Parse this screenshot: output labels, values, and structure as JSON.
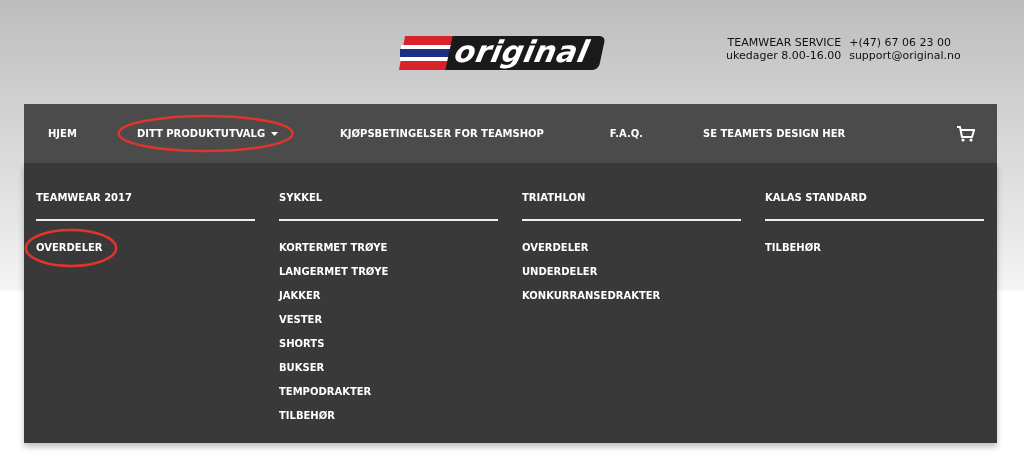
{
  "logo": {
    "text": "original"
  },
  "contact": [
    {
      "label": "TEAMWEAR SERVICE",
      "value": "+(47) 67 06 23 00"
    },
    {
      "label": "ukedager 8.00-16.00",
      "value": "support@original.no"
    }
  ],
  "nav": [
    {
      "label": "HJEM",
      "dropdown": false,
      "circled": false
    },
    {
      "label": "DITT PRODUKTUTVALG",
      "dropdown": true,
      "circled": true
    },
    {
      "label": "KJØPSBETINGELSER FOR TEAMSHOP",
      "dropdown": false,
      "circled": false
    },
    {
      "label": "F.A.Q.",
      "dropdown": false,
      "circled": false
    },
    {
      "label": "SE TEAMETS DESIGN HER",
      "dropdown": false,
      "circled": false
    }
  ],
  "menu_columns": [
    {
      "heading": "TEAMWEAR 2017",
      "items": [
        {
          "label": "OVERDELER",
          "circled": true
        }
      ]
    },
    {
      "heading": "SYKKEL",
      "items": [
        {
          "label": "KORTERMET TRØYE",
          "circled": false
        },
        {
          "label": "LANGERMET TRØYE",
          "circled": false
        },
        {
          "label": "JAKKER",
          "circled": false
        },
        {
          "label": "VESTER",
          "circled": false
        },
        {
          "label": "SHORTS",
          "circled": false
        },
        {
          "label": "BUKSER",
          "circled": false
        },
        {
          "label": "TEMPODRAKTER",
          "circled": false
        },
        {
          "label": "TILBEHØR",
          "circled": false
        }
      ]
    },
    {
      "heading": "TRIATHLON",
      "items": [
        {
          "label": "OVERDELER",
          "circled": false
        },
        {
          "label": "UNDERDELER",
          "circled": false
        },
        {
          "label": "KONKURRANSEDRAKTER",
          "circled": false
        }
      ]
    },
    {
      "heading": "KALAS STANDARD",
      "items": [
        {
          "label": "TILBEHØR",
          "circled": false
        }
      ]
    }
  ]
}
